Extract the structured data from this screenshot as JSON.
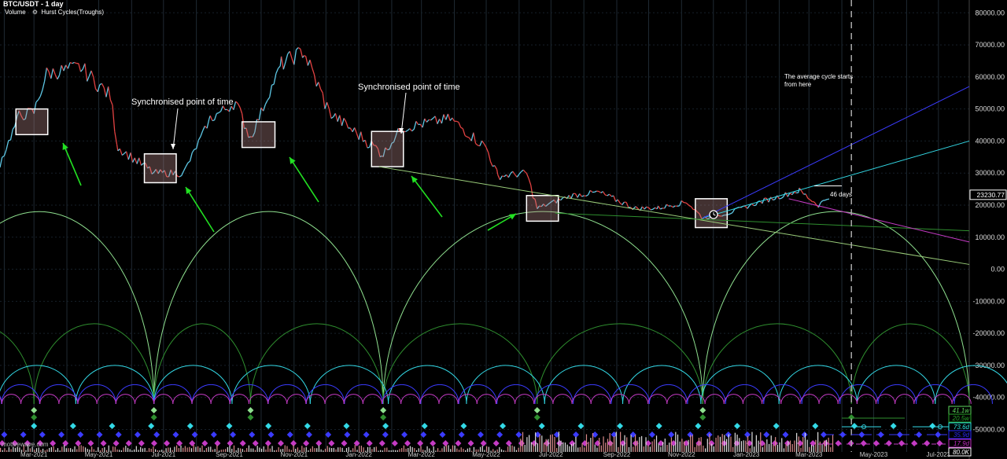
{
  "header": {
    "title": "BTC/USDT - 1 day",
    "volume_label": "Volume",
    "indicator_label": "Hurst Cycles(Troughs)",
    "gear_icon": "gear-icon"
  },
  "watermark": "motivewave.com",
  "annotations": {
    "sync1": "Synchronised point of time",
    "sync2": "Synchronised point of time",
    "avg_cycle_line1": "The average cycle starts",
    "avg_cycle_line2": "from here",
    "days": "46 days"
  },
  "chart_data": {
    "type": "line",
    "title": "BTC/USDT - 1 day",
    "y_axis": {
      "ticks": [
        "80000.00",
        "70000.00",
        "60000.00",
        "50000.00",
        "40000.00",
        "30000.00",
        "20000.00",
        "10000.00",
        "0.00",
        "-10000.00",
        "-20000.00",
        "-30000.00",
        "-40000.00",
        "-50000.00"
      ],
      "ylim": [
        -57000,
        84000
      ]
    },
    "x_axis": {
      "ticks": [
        "Mar-2021",
        "May-2021",
        "Jul-2021",
        "Sep-2021",
        "Nov-2021",
        "Jan-2022",
        "Mar-2022",
        "May-2022",
        "Jul-2022",
        "Sep-2022",
        "Nov-2022",
        "Jan-2023",
        "Mar-2023",
        "May-2023",
        "Jul-2023"
      ],
      "range": [
        "2021-01-28",
        "2023-07-30"
      ]
    },
    "price_series": {
      "name": "BTC/USDT",
      "x": [
        "2021-01-28",
        "2021-02-15",
        "2021-03-01",
        "2021-03-13",
        "2021-04-14",
        "2021-05-12",
        "2021-05-19",
        "2021-06-22",
        "2021-07-20",
        "2021-08-14",
        "2021-09-07",
        "2021-09-21",
        "2021-10-20",
        "2021-11-10",
        "2021-12-04",
        "2022-01-24",
        "2022-02-10",
        "2022-03-28",
        "2022-05-01",
        "2022-05-12",
        "2022-06-08",
        "2022-06-18",
        "2022-07-20",
        "2022-08-15",
        "2022-09-19",
        "2022-10-10",
        "2022-11-06",
        "2022-11-21",
        "2022-12-15",
        "2023-01-14",
        "2023-02-20",
        "2023-03-10",
        "2023-03-22"
      ],
      "close": [
        33000,
        48000,
        49000,
        61000,
        63000,
        54000,
        38000,
        30000,
        30000,
        47000,
        52000,
        41000,
        64000,
        68000,
        49000,
        36000,
        44000,
        47000,
        38000,
        29000,
        30000,
        19000,
        23000,
        24000,
        19000,
        19100,
        21000,
        16000,
        17500,
        21000,
        24500,
        20000,
        23230
      ]
    },
    "last_price": "23230.77",
    "right_axis_tags": [
      {
        "label": "41.1w",
        "color": "#5bd65b"
      },
      {
        "label": "20.5w",
        "color": "#2aa52a"
      },
      {
        "label": "73.6d",
        "color": "#2ae6e6"
      },
      {
        "label": "35.9d",
        "color": "#2a2aff"
      },
      {
        "label": "17.9d",
        "color": "#c02ac0"
      },
      {
        "label": "80.0K",
        "color": "#ffffff"
      }
    ],
    "cycle_troughs": [
      "2021-03-01",
      "2021-06-22",
      "2021-09-21",
      "2022-01-24",
      "2022-06-18",
      "2022-11-21",
      "2023-04-10"
    ],
    "future_trough_marker": "2023-04-10",
    "cycles": [
      {
        "name": "41.1w",
        "color": "#8fe08f",
        "troughs": [
          "2021-06-22",
          "2022-01-24",
          "2022-11-21",
          "2023-07-30"
        ],
        "amplitude": 60000
      },
      {
        "name": "20.5w",
        "color": "#2f8f2f",
        "troughs": [
          "2021-03-01",
          "2021-06-22",
          "2021-09-21",
          "2022-01-24",
          "2022-06-18",
          "2022-11-21",
          "2023-04-10",
          "2023-07-30"
        ],
        "amplitude": 25000
      },
      {
        "name": "73.6d",
        "color": "#33d9e6",
        "period_days": 73.6,
        "amplitude": 12000
      },
      {
        "name": "35.9d",
        "color": "#3b3bff",
        "period_days": 35.9,
        "amplitude": 6000
      },
      {
        "name": "17.9d",
        "color": "#c43bc4",
        "period_days": 17.9,
        "amplitude": 3000
      }
    ],
    "sync_boxes": [
      {
        "from": "2021-02-12",
        "to": "2021-03-14",
        "low": 42000,
        "high": 50000
      },
      {
        "from": "2021-06-13",
        "to": "2021-07-13",
        "low": 27000,
        "high": 36000
      },
      {
        "from": "2021-09-13",
        "to": "2021-10-14",
        "low": 38000,
        "high": 46000
      },
      {
        "from": "2022-01-13",
        "to": "2022-02-12",
        "low": 32000,
        "high": 43000
      },
      {
        "from": "2022-06-08",
        "to": "2022-07-08",
        "low": 15000,
        "high": 23000
      },
      {
        "from": "2022-11-14",
        "to": "2022-12-14",
        "low": 13000,
        "high": 22000
      }
    ],
    "trend_lines": [
      {
        "color": "#9acd7a",
        "from": [
          "2022-01-20",
          32000
        ],
        "to": [
          "2023-07-30",
          1500
        ]
      },
      {
        "color": "#2f8f2f",
        "from": [
          "2022-07-05",
          17500
        ],
        "to": [
          "2023-07-30",
          12000
        ]
      },
      {
        "color": "#33d9e6",
        "from": [
          "2022-11-21",
          16000
        ],
        "to": [
          "2023-07-30",
          40000
        ]
      },
      {
        "color": "#3b3bff",
        "from": [
          "2022-11-21",
          16000
        ],
        "to": [
          "2023-07-30",
          57000
        ]
      },
      {
        "color": "#c43bc4",
        "from": [
          "2023-02-10",
          22000
        ],
        "to": [
          "2023-07-30",
          8500
        ]
      },
      {
        "color": "#ffffff",
        "from": [
          "2023-03-06",
          26000
        ],
        "to": [
          "2023-04-01",
          26000
        ]
      }
    ],
    "vertical_dashed": "2023-04-10"
  }
}
